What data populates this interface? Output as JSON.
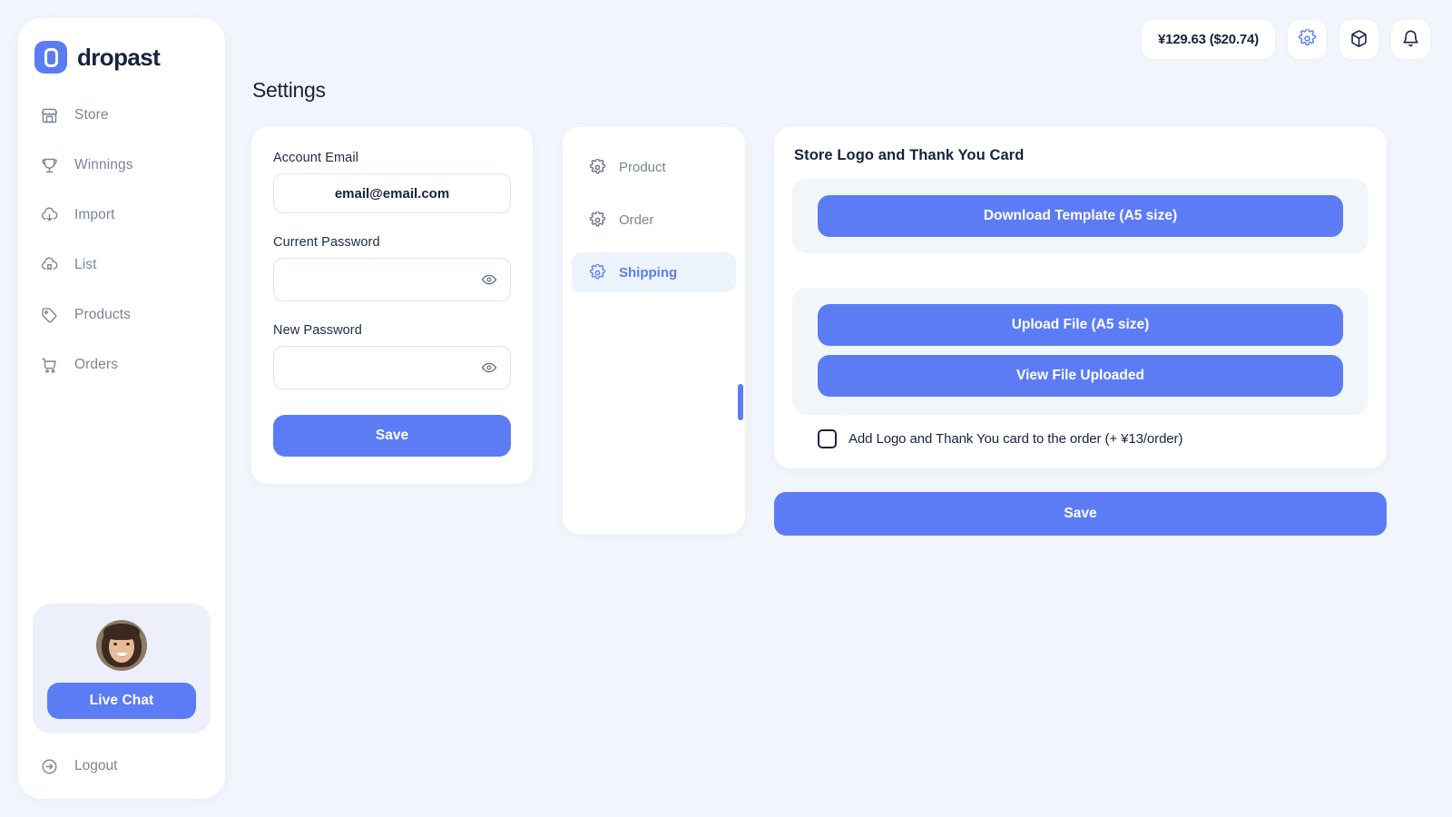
{
  "brand": {
    "name": "dropast",
    "logo_icon": "dropast-logo-icon",
    "accent_color": "#5C7CF5"
  },
  "sidebar": {
    "items": [
      {
        "label": "Store",
        "icon": "store-icon"
      },
      {
        "label": "Winnings",
        "icon": "trophy-icon"
      },
      {
        "label": "Import",
        "icon": "cloud-download-icon"
      },
      {
        "label": "List",
        "icon": "cloud-list-icon"
      },
      {
        "label": "Products",
        "icon": "tag-icon"
      },
      {
        "label": "Orders",
        "icon": "shopping-cart-icon"
      }
    ],
    "live_chat": {
      "button_label": "Live Chat",
      "avatar_icon": "support-agent-avatar"
    },
    "logout": {
      "label": "Logout",
      "icon": "logout-icon"
    }
  },
  "topbar": {
    "balance": "¥129.63 ($20.74)",
    "buttons": [
      {
        "icon": "gear-icon",
        "name": "settings-icon-button"
      },
      {
        "icon": "box-icon",
        "name": "package-icon-button"
      },
      {
        "icon": "bell-icon",
        "name": "notifications-icon-button"
      }
    ]
  },
  "page": {
    "title": "Settings"
  },
  "account": {
    "email_label": "Account Email",
    "email_value": "email@email.com",
    "email_placeholder": "email@email.com",
    "current_password_label": "Current Password",
    "current_password_value": "",
    "current_password_placeholder": "",
    "new_password_label": "New Password",
    "new_password_value": "",
    "new_password_placeholder": "",
    "save_label": "Save",
    "reveal_icon": "eye-icon"
  },
  "settings_nav": {
    "items": [
      {
        "label": "Product",
        "icon": "gear-icon",
        "active": false
      },
      {
        "label": "Order",
        "icon": "gear-icon",
        "active": false
      },
      {
        "label": "Shipping",
        "icon": "gear-icon",
        "active": true
      }
    ]
  },
  "shipping_panel": {
    "heading": "Store Logo and Thank You Card",
    "download_template_label": "Download Template (A5 size)",
    "upload_file_label": "Upload File (A5 size)",
    "view_file_label": "View File Uploaded",
    "checkbox_label": "Add Logo and Thank You card to the order (+ ¥13/order)",
    "checkbox_checked": false,
    "save_label": "Save"
  }
}
